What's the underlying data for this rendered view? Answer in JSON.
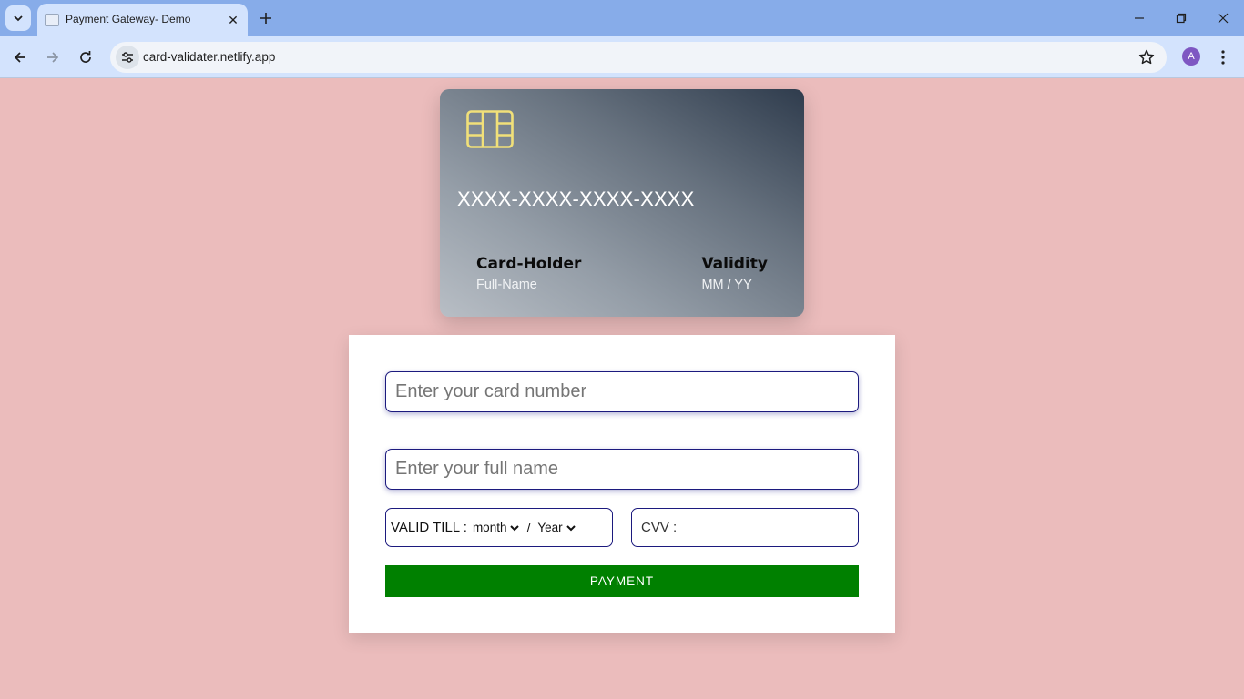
{
  "browser": {
    "tab_title": "Payment Gateway- Demo",
    "url": "card-validater.netlify.app",
    "profile_initial": "A"
  },
  "card_preview": {
    "number": "XXXX-XXXX-XXXX-XXXX",
    "holder_label": "Card-Holder",
    "holder_value": "Full-Name",
    "validity_label": "Validity",
    "validity_value": "MM / YY"
  },
  "form": {
    "card_number_placeholder": "Enter your card number",
    "name_placeholder": "Enter your full name",
    "valid_till_label": "VALID TILL :",
    "month_selected": "month",
    "separator": "/",
    "year_selected": "Year",
    "cvv_label": "CVV :",
    "payment_button": "PAYMENT"
  },
  "colors": {
    "page_background": "#ebbcbc",
    "payment_button": "#008000",
    "input_border": "#1c1a7e",
    "chip": "#f1e079"
  }
}
